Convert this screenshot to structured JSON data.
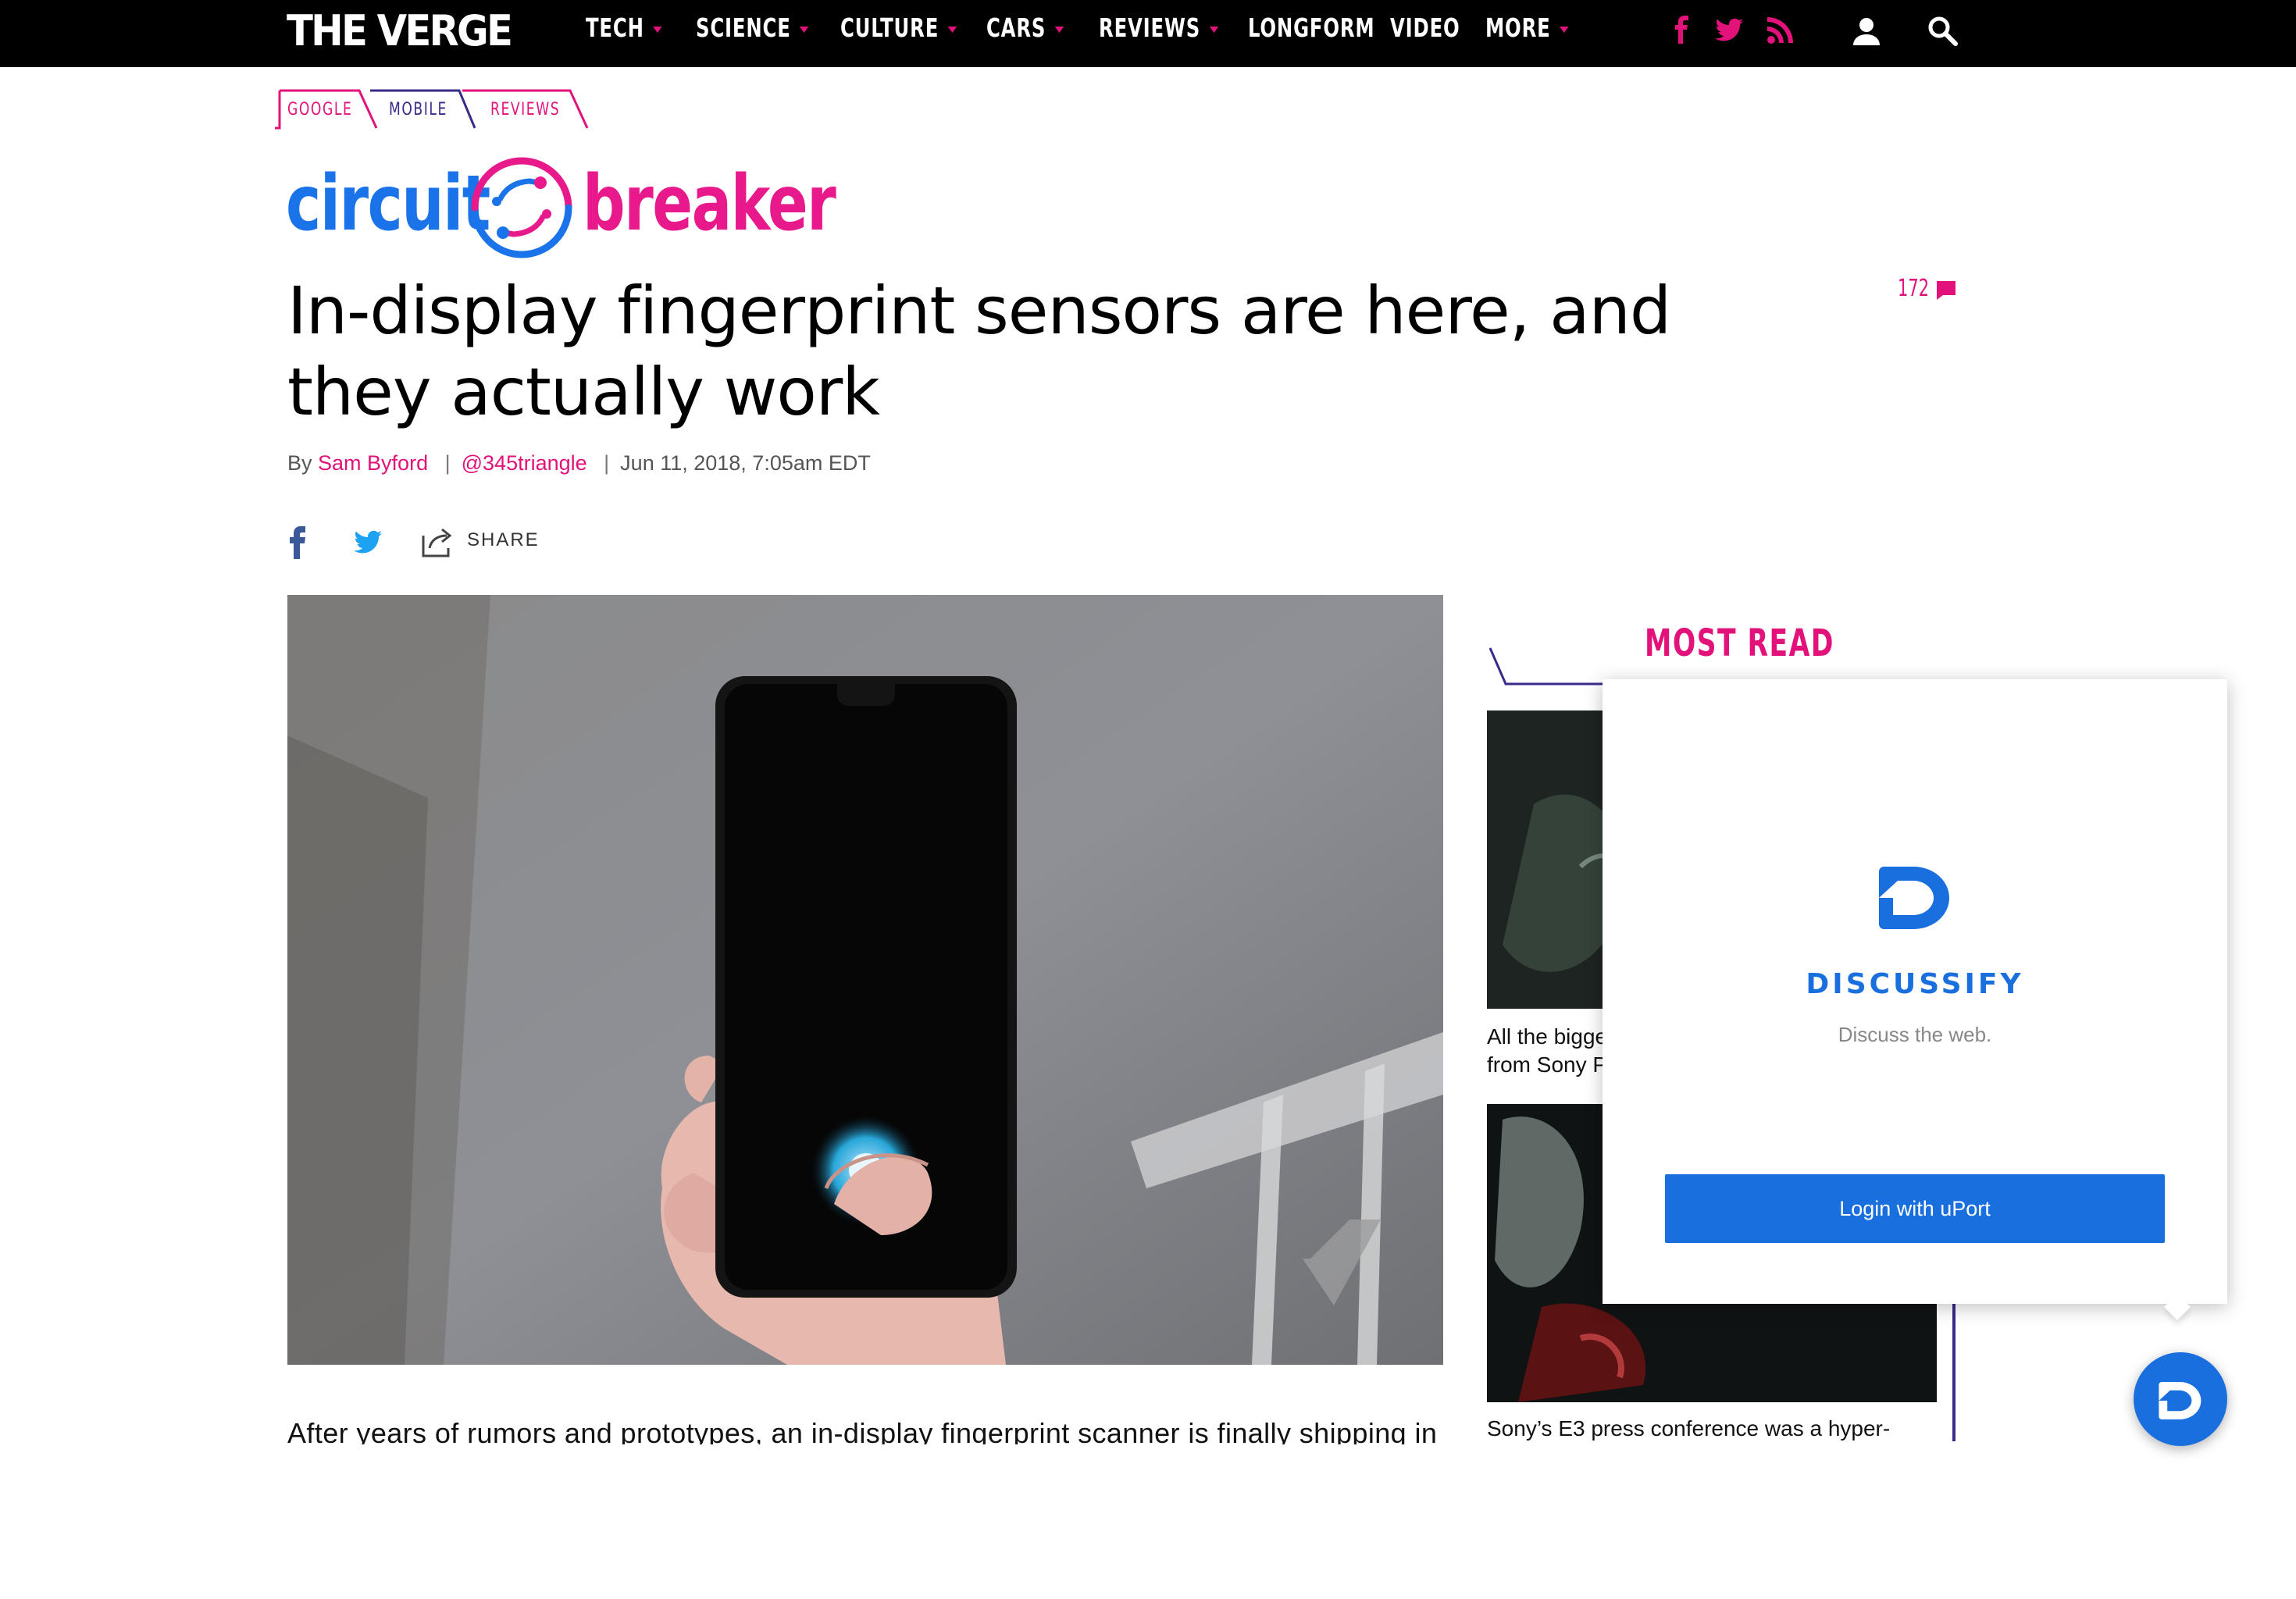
{
  "nav": {
    "logo": "THE VERGE",
    "items": [
      {
        "label": "TECH",
        "dropdown": true
      },
      {
        "label": "SCIENCE",
        "dropdown": true
      },
      {
        "label": "CULTURE",
        "dropdown": true
      },
      {
        "label": "CARS",
        "dropdown": true
      },
      {
        "label": "REVIEWS",
        "dropdown": true
      },
      {
        "label": "LONGFORM",
        "dropdown": false
      },
      {
        "label": "VIDEO",
        "dropdown": false
      },
      {
        "label": "MORE",
        "dropdown": true
      }
    ],
    "social_icons": [
      "facebook-icon",
      "twitter-icon",
      "rss-icon"
    ],
    "account_icon": "user-icon",
    "search_icon": "search-icon"
  },
  "breadcrumbs": [
    "GOOGLE",
    "MOBILE",
    "REVIEWS"
  ],
  "section_brand": {
    "left": "circuit",
    "right": "breaker"
  },
  "article": {
    "headline": "In-display fingerprint sensors are here, and they actually work",
    "comment_count": "172",
    "byline_prefix": "By",
    "author": "Sam Byford",
    "handle": "@345triangle",
    "date": "Jun 11, 2018, 7:05am EDT",
    "share_label": "SHARE",
    "body_first_line": "After years of rumors and prototypes, an in-display fingerprint scanner is finally shipping in"
  },
  "sidebar": {
    "heading": "MOST READ",
    "items": [
      {
        "caption_line1": "All the bigge",
        "caption_line2": "from Sony P"
      },
      {
        "caption_line1": "Sony’s E3 press conference was a hyper-"
      }
    ]
  },
  "popup": {
    "brand": "DISCUSSIFY",
    "tagline": "Discuss the web.",
    "login_label": "Login with uPort"
  },
  "colors": {
    "accent_pink": "#e2127a",
    "nav_bg": "#000000",
    "discussify_blue": "#1a6fde",
    "circuit_blue": "#1a73e8",
    "breaker_pink": "#e8198b",
    "purple": "#5a2d8c"
  }
}
